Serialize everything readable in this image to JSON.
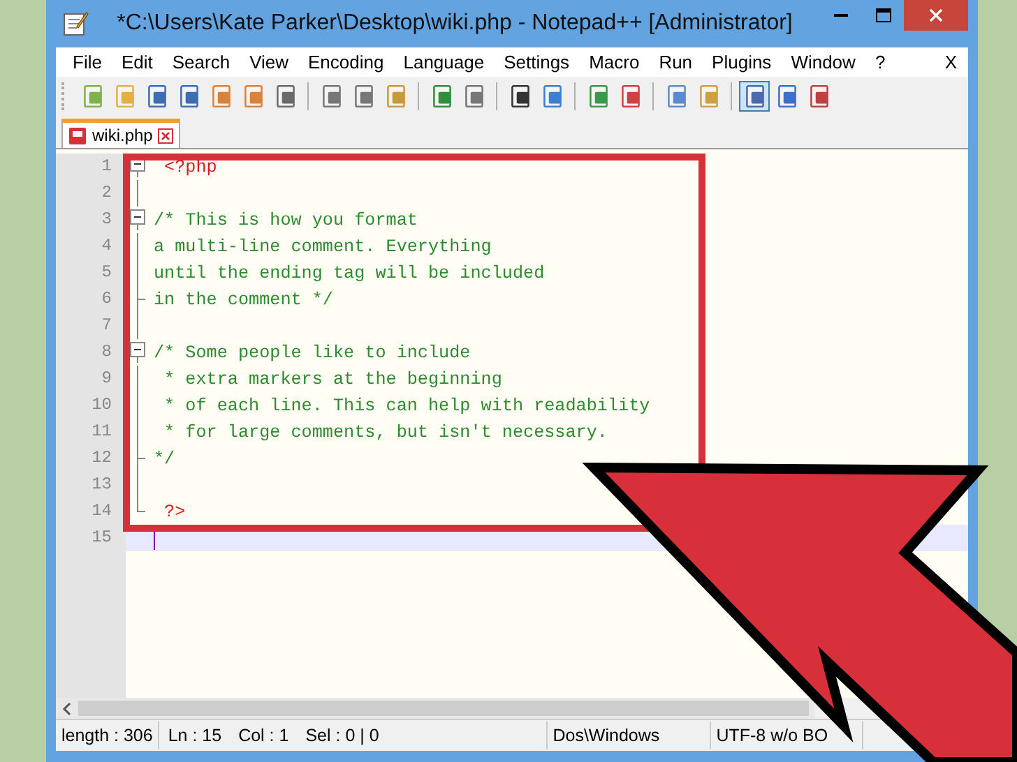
{
  "window": {
    "title": "*C:\\Users\\Kate Parker\\Desktop\\wiki.php - Notepad++ [Administrator]"
  },
  "menu": [
    "File",
    "Edit",
    "Search",
    "View",
    "Encoding",
    "Language",
    "Settings",
    "Macro",
    "Run",
    "Plugins",
    "Window",
    "?"
  ],
  "menu_close": "X",
  "toolbar": [
    {
      "pressed": false
    },
    {
      "pressed": false
    },
    {
      "pressed": false
    },
    {
      "pressed": false
    },
    {
      "pressed": false
    },
    {
      "pressed": false
    },
    {
      "pressed": false
    },
    {
      "pressed": false
    },
    {
      "pressed": false
    },
    {
      "pressed": false
    },
    {
      "pressed": false
    },
    {
      "pressed": false
    },
    {
      "pressed": false
    },
    {
      "pressed": false
    },
    {
      "pressed": false
    },
    {
      "pressed": false
    },
    {
      "pressed": false
    },
    {
      "pressed": false
    },
    {
      "pressed": true
    },
    {
      "pressed": false
    },
    {
      "pressed": false
    }
  ],
  "tabs": [
    {
      "label": "wiki.php",
      "selected": true
    }
  ],
  "editor": {
    "lines": [
      {
        "number": "1",
        "text": " <?php",
        "kind": "tag-open",
        "current": false
      },
      {
        "number": "2",
        "kind": "blank",
        "current": false
      },
      {
        "number": "3",
        "text": "/* This is how you format",
        "kind": "comment-open",
        "current": false
      },
      {
        "number": "4",
        "text": "a multi-line comment. Everything",
        "kind": "comment",
        "current": false
      },
      {
        "number": "5",
        "text": "until the ending tag will be included",
        "kind": "comment",
        "current": false
      },
      {
        "number": "6",
        "text": "in the comment */",
        "kind": "comment-close",
        "current": false
      },
      {
        "number": "7",
        "kind": "blank",
        "current": false
      },
      {
        "number": "8",
        "text": "/* Some people like to include",
        "kind": "comment-open",
        "current": false
      },
      {
        "number": "9",
        "text": " * extra markers at the beginning",
        "kind": "comment",
        "current": false
      },
      {
        "number": "10",
        "text": " * of each line. This can help with readability",
        "kind": "comment",
        "current": false
      },
      {
        "number": "11",
        "text": " * for large comments, but isn't necessary.",
        "kind": "comment",
        "current": false
      },
      {
        "number": "12",
        "text": "*/",
        "kind": "comment-close",
        "current": false
      },
      {
        "number": "13",
        "kind": "blank",
        "current": false
      },
      {
        "number": "14",
        "text": " ?>",
        "kind": "tag-close",
        "current": false
      },
      {
        "number": "15",
        "kind": "empty",
        "current": true
      }
    ]
  },
  "status_bar": [
    {
      "text": "length : 306",
      "kind": "cell"
    },
    {
      "text": "Ln : 15",
      "kind": "inline"
    },
    {
      "text": "Col : 1",
      "kind": "inline"
    },
    {
      "text": "Sel : 0 | 0",
      "kind": "inline"
    },
    {
      "text": "Dos\\Windows",
      "kind": "cell"
    },
    {
      "text": "UTF-8 w/o BO",
      "kind": "cell"
    }
  ]
}
